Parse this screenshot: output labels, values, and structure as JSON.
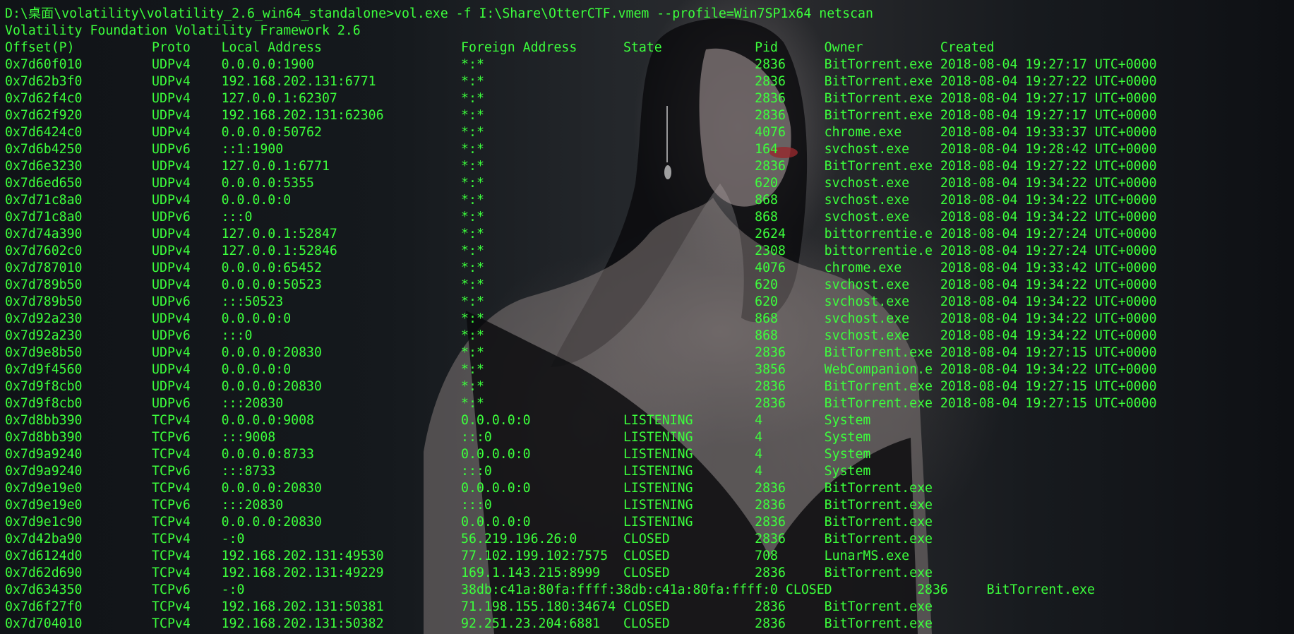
{
  "terminal": {
    "prompt_line": "D:\\桌面\\volatility\\volatility_2.6_win64_standalone>vol.exe -f I:\\Share\\OtterCTF.vmem --profile=Win7SP1x64 netscan",
    "banner_line": "Volatility Foundation Volatility Framework 2.6",
    "header_line": "Offset(P)          Proto    Local Address                  Foreign Address      State            Pid      Owner          Created",
    "rows": [
      "0x7d60f010         UDPv4    0.0.0.0:1900                   *:*                                   2836     BitTorrent.exe 2018-08-04 19:27:17 UTC+0000",
      "0x7d62b3f0         UDPv4    192.168.202.131:6771           *:*                                   2836     BitTorrent.exe 2018-08-04 19:27:22 UTC+0000",
      "0x7d62f4c0         UDPv4    127.0.0.1:62307                *:*                                   2836     BitTorrent.exe 2018-08-04 19:27:17 UTC+0000",
      "0x7d62f920         UDPv4    192.168.202.131:62306          *:*                                   2836     BitTorrent.exe 2018-08-04 19:27:17 UTC+0000",
      "0x7d6424c0         UDPv4    0.0.0.0:50762                  *:*                                   4076     chrome.exe     2018-08-04 19:33:37 UTC+0000",
      "0x7d6b4250         UDPv6    ::1:1900                       *:*                                   164      svchost.exe    2018-08-04 19:28:42 UTC+0000",
      "0x7d6e3230         UDPv4    127.0.0.1:6771                 *:*                                   2836     BitTorrent.exe 2018-08-04 19:27:22 UTC+0000",
      "0x7d6ed650         UDPv4    0.0.0.0:5355                   *:*                                   620      svchost.exe    2018-08-04 19:34:22 UTC+0000",
      "0x7d71c8a0         UDPv4    0.0.0.0:0                      *:*                                   868      svchost.exe    2018-08-04 19:34:22 UTC+0000",
      "0x7d71c8a0         UDPv6    :::0                           *:*                                   868      svchost.exe    2018-08-04 19:34:22 UTC+0000",
      "0x7d74a390         UDPv4    127.0.0.1:52847                *:*                                   2624     bittorrentie.e 2018-08-04 19:27:24 UTC+0000",
      "0x7d7602c0         UDPv4    127.0.0.1:52846                *:*                                   2308     bittorrentie.e 2018-08-04 19:27:24 UTC+0000",
      "0x7d787010         UDPv4    0.0.0.0:65452                  *:*                                   4076     chrome.exe     2018-08-04 19:33:42 UTC+0000",
      "0x7d789b50         UDPv4    0.0.0.0:50523                  *:*                                   620      svchost.exe    2018-08-04 19:34:22 UTC+0000",
      "0x7d789b50         UDPv6    :::50523                       *:*                                   620      svchost.exe    2018-08-04 19:34:22 UTC+0000",
      "0x7d92a230         UDPv4    0.0.0.0:0                      *:*                                   868      svchost.exe    2018-08-04 19:34:22 UTC+0000",
      "0x7d92a230         UDPv6    :::0                           *:*                                   868      svchost.exe    2018-08-04 19:34:22 UTC+0000",
      "0x7d9e8b50         UDPv4    0.0.0.0:20830                  *:*                                   2836     BitTorrent.exe 2018-08-04 19:27:15 UTC+0000",
      "0x7d9f4560         UDPv4    0.0.0.0:0                      *:*                                   3856     WebCompanion.e 2018-08-04 19:34:22 UTC+0000",
      "0x7d9f8cb0         UDPv4    0.0.0.0:20830                  *:*                                   2836     BitTorrent.exe 2018-08-04 19:27:15 UTC+0000",
      "0x7d9f8cb0         UDPv6    :::20830                       *:*                                   2836     BitTorrent.exe 2018-08-04 19:27:15 UTC+0000",
      "0x7d8bb390         TCPv4    0.0.0.0:9008                   0.0.0.0:0            LISTENING        4        System",
      "0x7d8bb390         TCPv6    :::9008                        :::0                 LISTENING        4        System",
      "0x7d9a9240         TCPv4    0.0.0.0:8733                   0.0.0.0:0            LISTENING        4        System",
      "0x7d9a9240         TCPv6    :::8733                        :::0                 LISTENING        4        System",
      "0x7d9e19e0         TCPv4    0.0.0.0:20830                  0.0.0.0:0            LISTENING        2836     BitTorrent.exe",
      "0x7d9e19e0         TCPv6    :::20830                       :::0                 LISTENING        2836     BitTorrent.exe",
      "0x7d9e1c90         TCPv4    0.0.0.0:20830                  0.0.0.0:0            LISTENING        2836     BitTorrent.exe",
      "0x7d42ba90         TCPv4    -:0                            56.219.196.26:0      CLOSED           2836     BitTorrent.exe",
      "0x7d6124d0         TCPv4    192.168.202.131:49530          77.102.199.102:7575  CLOSED           708      LunarMS.exe",
      "0x7d62d690         TCPv4    192.168.202.131:49229          169.1.143.215:8999   CLOSED           2836     BitTorrent.exe",
      "0x7d634350         TCPv6    -:0                            38db:c41a:80fa:ffff:38db:c41a:80fa:ffff:0 CLOSED           2836     BitTorrent.exe",
      "0x7d6f27f0         TCPv4    192.168.202.131:50381          71.198.155.180:34674 CLOSED           2836     BitTorrent.exe",
      "0x7d704010         TCPv4    192.168.202.131:50382          92.251.23.204:6881   CLOSED           2836     BitTorrent.exe"
    ]
  },
  "colors": {
    "text": "#3cff3c",
    "background": "#0b0d10"
  }
}
